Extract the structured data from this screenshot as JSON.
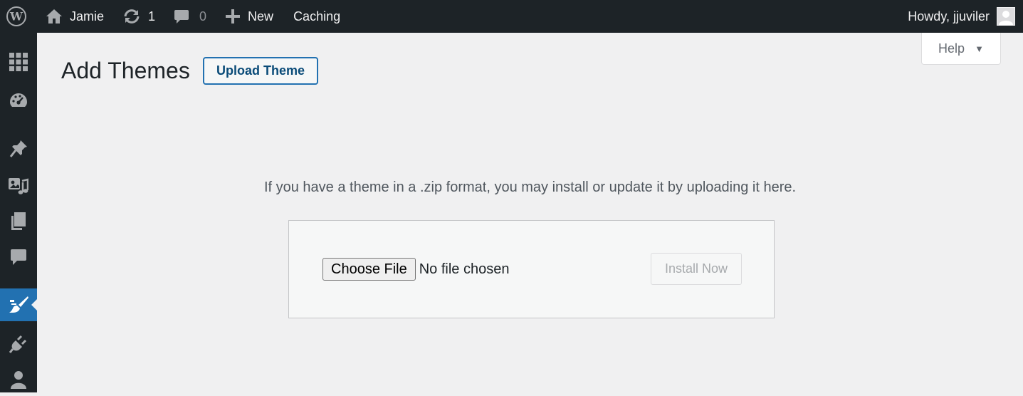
{
  "admin_bar": {
    "site_name": "Jamie",
    "updates_count": "1",
    "comments_count": "0",
    "new_label": "New",
    "caching_label": "Caching",
    "howdy": "Howdy, jjuviler"
  },
  "help": {
    "label": "Help"
  },
  "page": {
    "title": "Add Themes",
    "upload_button": "Upload Theme",
    "upload_help": "If you have a theme in a .zip format, you may install or update it by uploading it here."
  },
  "upload_form": {
    "choose_file_label": "Choose File",
    "no_file_text": "No file chosen",
    "install_button": "Install Now"
  },
  "sidebar": {
    "items": [
      {
        "icon": "dashboard-grid-icon"
      },
      {
        "icon": "gauge-icon"
      },
      {
        "icon": "pushpin-icon"
      },
      {
        "icon": "media-icon"
      },
      {
        "icon": "pages-icon"
      },
      {
        "icon": "comment-icon"
      },
      {
        "icon": "paintbrush-icon",
        "current": true
      },
      {
        "icon": "plugin-icon"
      },
      {
        "icon": "user-icon"
      }
    ]
  },
  "colors": {
    "admin_bar_bg": "#1d2327",
    "accent": "#2271b1",
    "page_bg": "#f0f0f1"
  }
}
